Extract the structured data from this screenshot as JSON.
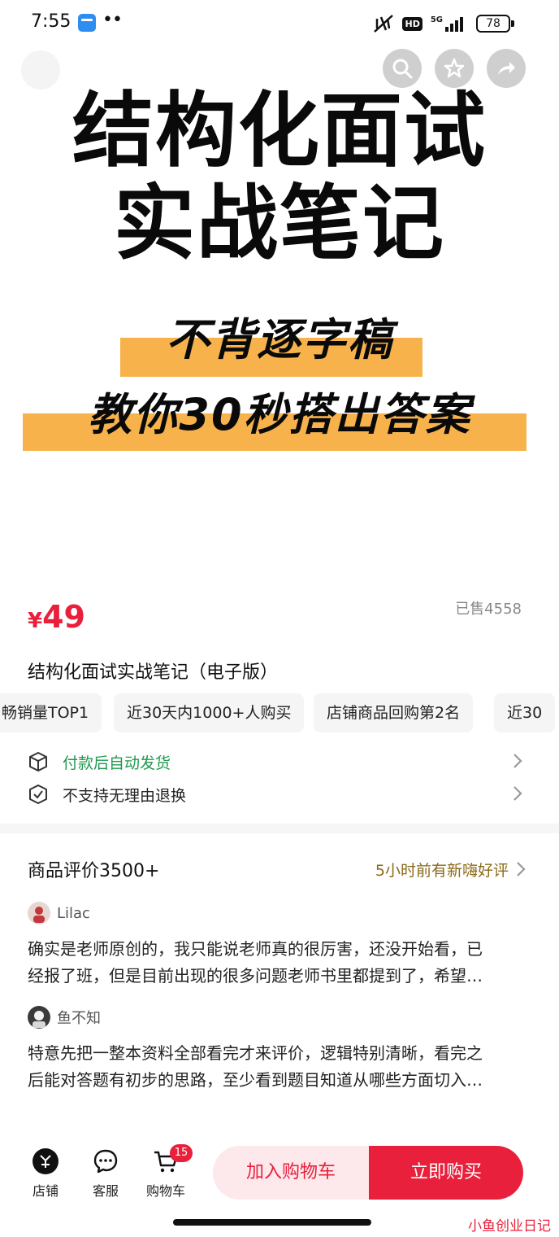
{
  "status_bar": {
    "time": "7:55",
    "dots": "••",
    "hd": "HD",
    "network": "5G",
    "battery": "78"
  },
  "hero": {
    "title_line1": "结构化面试",
    "title_line2": "实战笔记",
    "banner_line1": "不背逐字稿",
    "banner_line2": "教你30秒搭出答案",
    "highlight_color": "#f7b24b",
    "top_icons": [
      "search-icon",
      "star-icon",
      "share-icon"
    ]
  },
  "product": {
    "price_symbol": "¥",
    "price_value": "49",
    "sold": "已售4558",
    "title": "结构化面试实战笔记（电子版）",
    "price_color": "#e8203c"
  },
  "tags": [
    "畅销量TOP1",
    "近30天内1000+人购买",
    "店铺商品回购第2名",
    "近30"
  ],
  "services": [
    {
      "text": "付款后自动发货",
      "color": "#1f9a4e"
    },
    {
      "text": "不支持无理由退换",
      "color": "#222222"
    }
  ],
  "reviews": {
    "title": "商品评价3500+",
    "hint": "5小时前有新嗨好评",
    "items": [
      {
        "user": "Lilac",
        "line1": "确实是老师原创的，我只能说老师真的很厉害，还没开始看，已",
        "line2": "经报了班，但是目前出现的很多问题老师书里都提到了，希望…"
      },
      {
        "user": "鱼不知",
        "line1": "特意先把一整本资料全部看完才来评价，逻辑特别清晰，看完之",
        "line2": "后能对答题有初步的思路，至少看到题目知道从哪些方面切入…"
      }
    ]
  },
  "bottom_bar": {
    "shop_label": "店铺",
    "service_label": "客服",
    "cart_label": "购物车",
    "cart_count": "15",
    "add_to_cart": "加入购物车",
    "buy_now": "立即购买"
  },
  "watermark": "小鱼创业日记"
}
